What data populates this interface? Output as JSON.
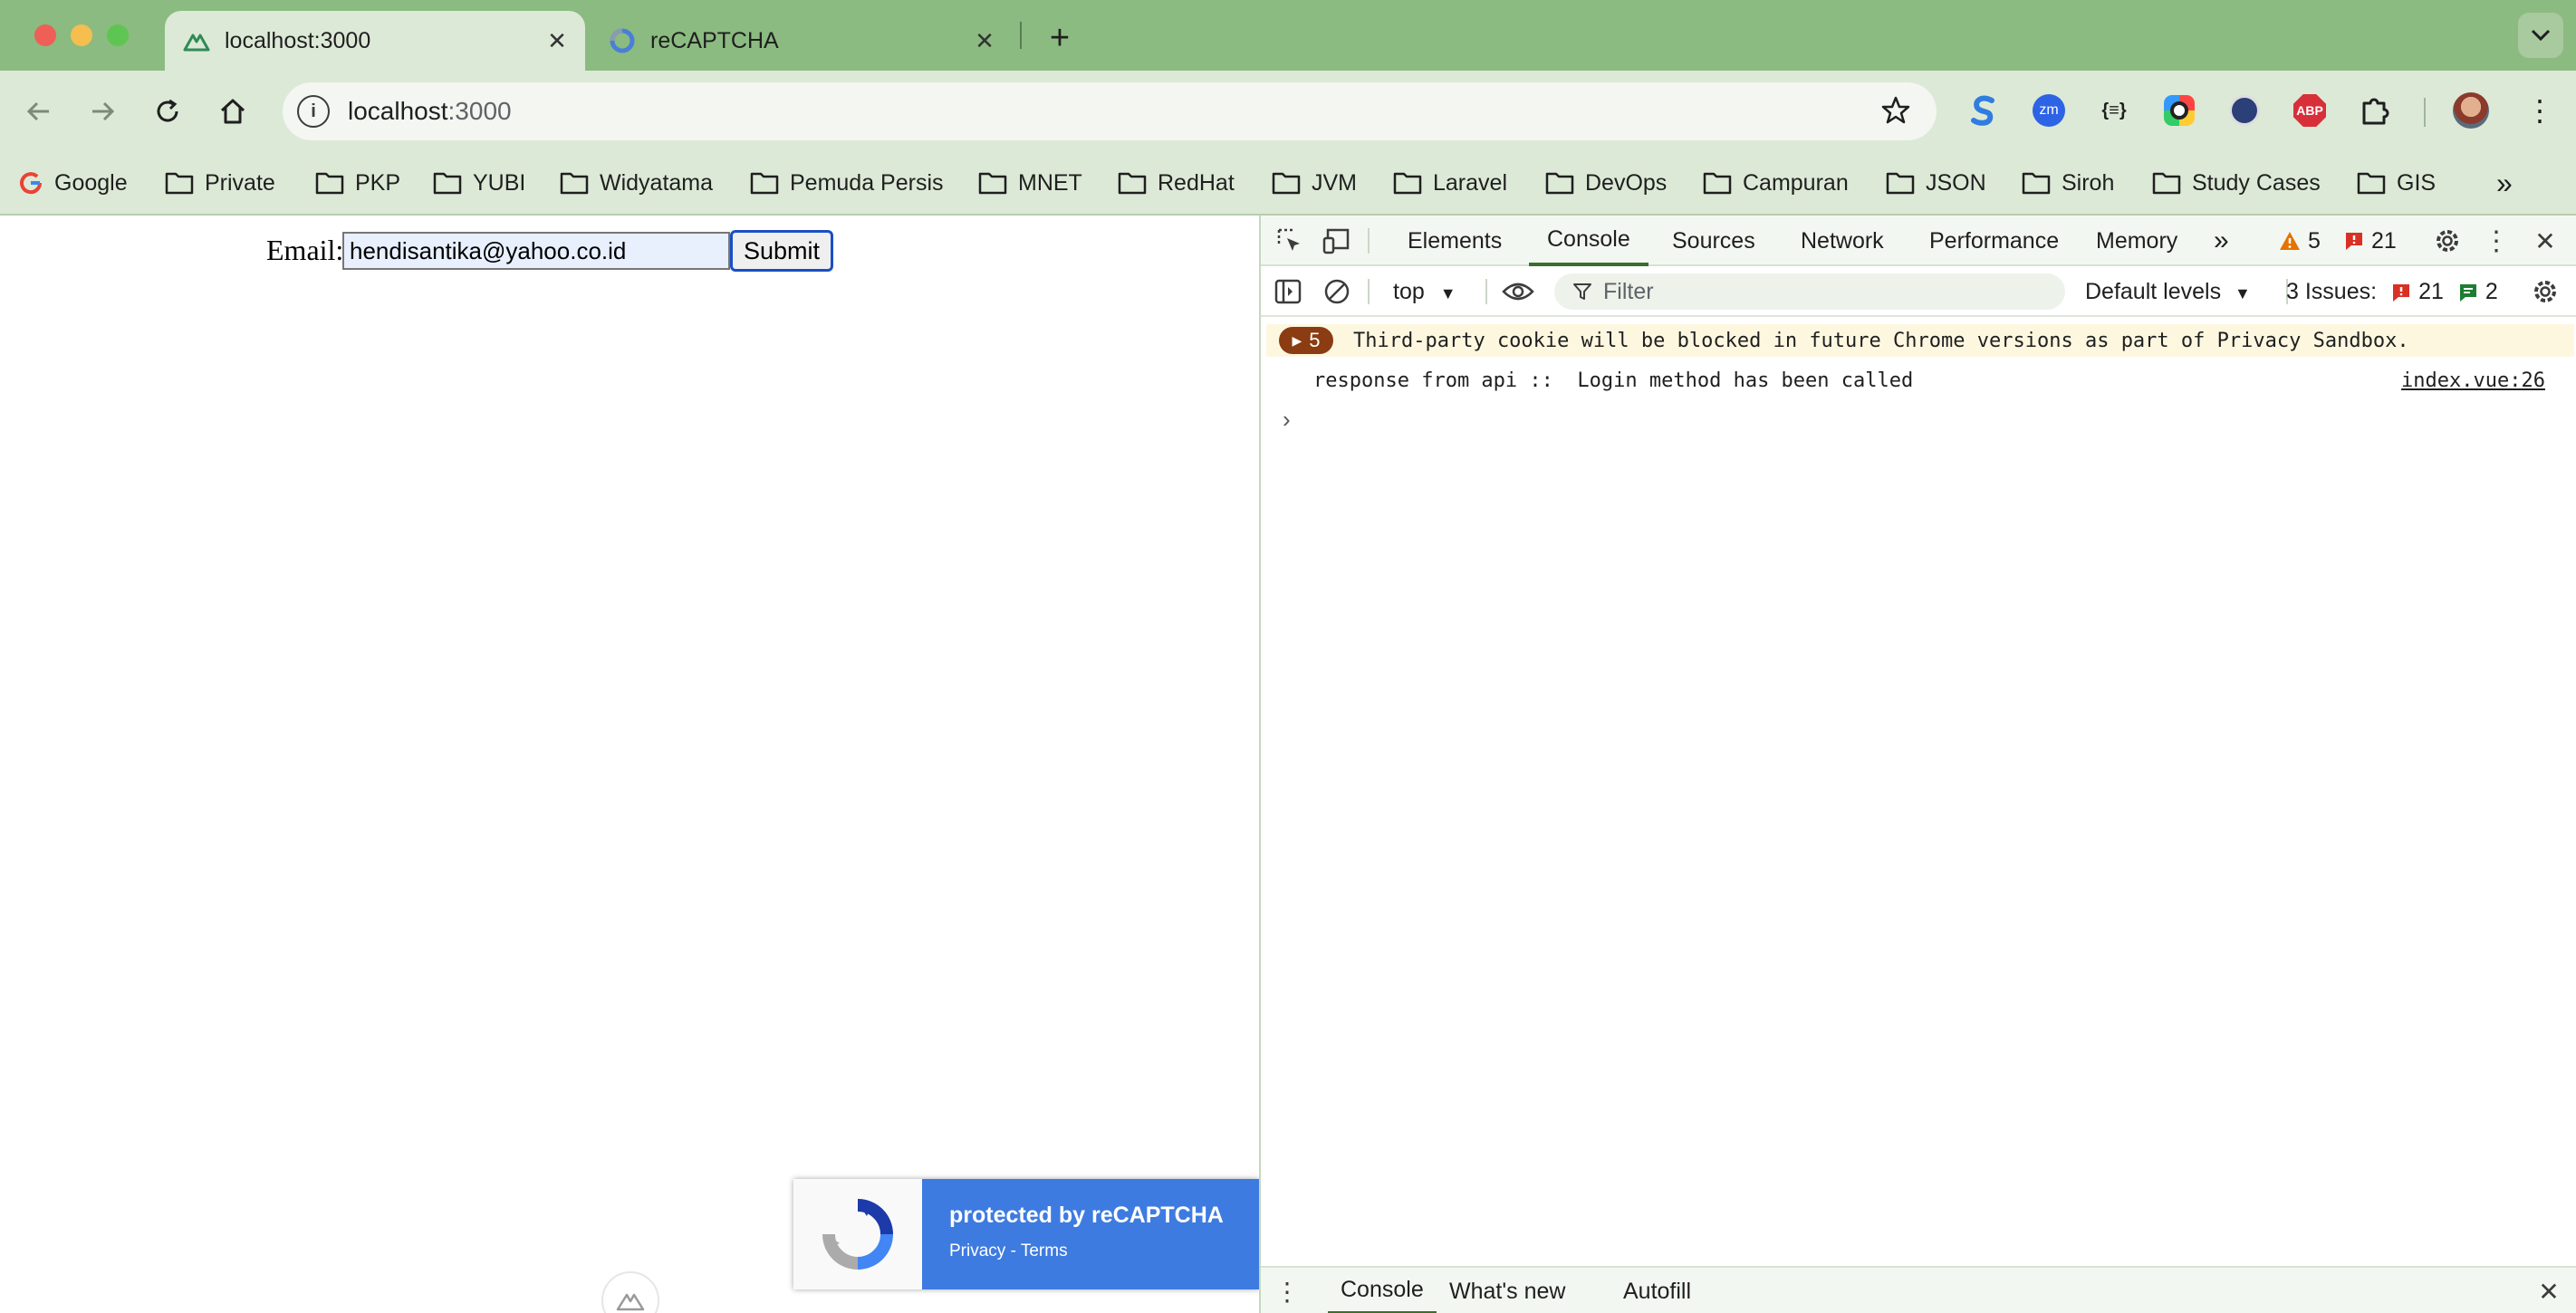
{
  "window": {
    "traffic_lights": {
      "close": "#ee5f57",
      "minimize": "#f5be4f",
      "zoom": "#5fc552"
    }
  },
  "tabs": [
    {
      "title": "localhost:3000",
      "icon": "nuxt-icon",
      "active": true
    },
    {
      "title": "reCAPTCHA",
      "icon": "recaptcha-icon",
      "active": false
    }
  ],
  "toolbar": {
    "url_host": "localhost",
    "url_port": ":3000"
  },
  "bookmarks": [
    {
      "label": "Google",
      "icon": "google-icon"
    },
    {
      "label": "Private",
      "icon": "folder-icon"
    },
    {
      "label": "PKP",
      "icon": "folder-icon"
    },
    {
      "label": "YUBI",
      "icon": "folder-icon"
    },
    {
      "label": "Widyatama",
      "icon": "folder-icon"
    },
    {
      "label": "Pemuda Persis",
      "icon": "folder-icon"
    },
    {
      "label": "MNET",
      "icon": "folder-icon"
    },
    {
      "label": "RedHat",
      "icon": "folder-icon"
    },
    {
      "label": "JVM",
      "icon": "folder-icon"
    },
    {
      "label": "Laravel",
      "icon": "folder-icon"
    },
    {
      "label": "DevOps",
      "icon": "folder-icon"
    },
    {
      "label": "Campuran",
      "icon": "folder-icon"
    },
    {
      "label": "JSON",
      "icon": "folder-icon"
    },
    {
      "label": "Siroh",
      "icon": "folder-icon"
    },
    {
      "label": "Study Cases",
      "icon": "folder-icon"
    },
    {
      "label": "GIS",
      "icon": "folder-icon"
    }
  ],
  "page": {
    "email_label": "Email:",
    "email_value": "hendisantika@yahoo.co.id",
    "submit_label": "Submit",
    "recaptcha": {
      "protected": "protected by reCAPTCHA",
      "privacy": "Privacy",
      "separator": " - ",
      "terms": "Terms"
    }
  },
  "devtools": {
    "tabs": [
      "Elements",
      "Console",
      "Sources",
      "Network",
      "Performance",
      "Memory"
    ],
    "active_tab": "Console",
    "warnings_count": "5",
    "errors_count": "21",
    "context": "top",
    "filter_placeholder": "Filter",
    "levels": "Default levels",
    "issues_label": "3 Issues:",
    "issues_errors": "21",
    "issues_info": "2",
    "messages": {
      "warning_count": "5",
      "warning_text": "Third-party cookie will be blocked in future Chrome versions as part of Privacy Sandbox.",
      "log_text": "response from api ::  Login method has been called",
      "log_source": "index.vue:26"
    },
    "drawer_tabs": [
      "Console",
      "What's new",
      "Autofill"
    ]
  }
}
